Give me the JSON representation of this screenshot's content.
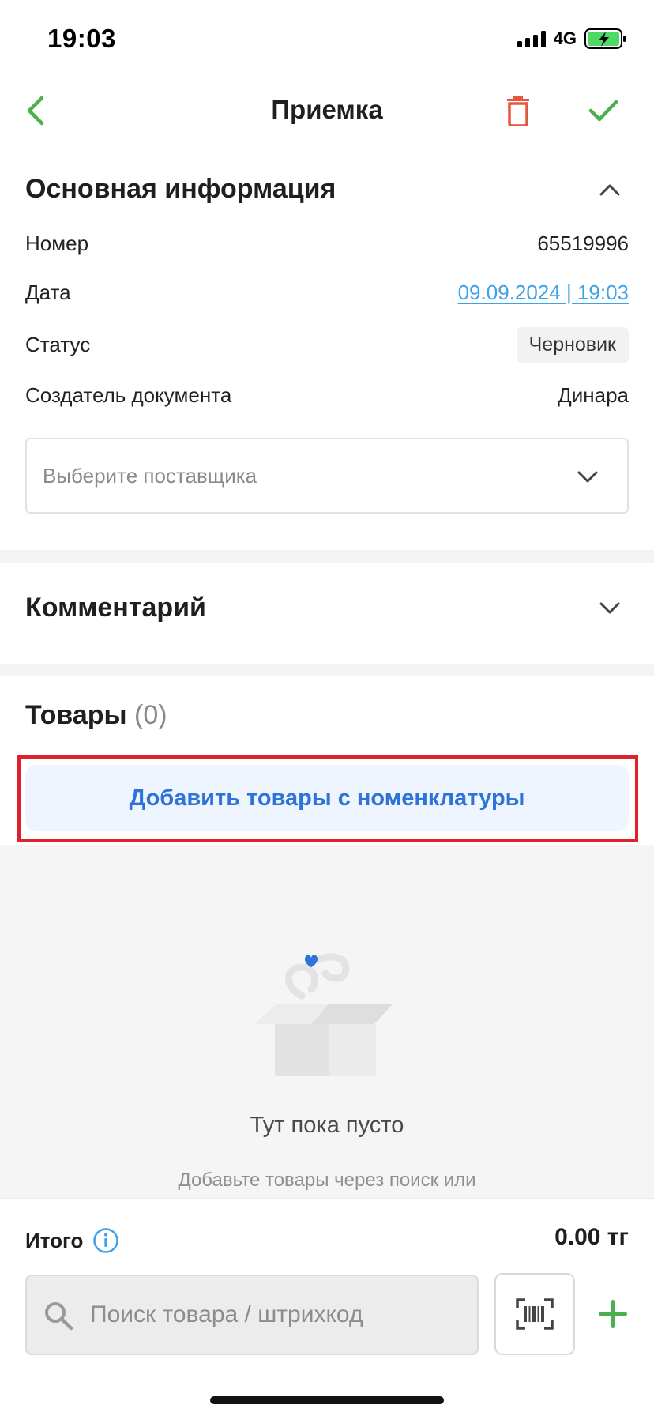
{
  "status_bar": {
    "time": "19:03",
    "network": "4G",
    "icons": [
      "signal-icon",
      "battery-charging-icon"
    ]
  },
  "header": {
    "title": "Приемка",
    "back_icon": "chevron-left-icon",
    "delete_icon": "trash-icon",
    "confirm_icon": "check-icon"
  },
  "colors": {
    "accent_green": "#4caf50",
    "delete_red": "#e5573c",
    "link_blue": "#3ea2ea",
    "button_blue": "#2f73d9",
    "button_bg": "#eef5fe",
    "highlight_red": "#e0212b"
  },
  "main_info": {
    "title": "Основная информация",
    "rows": [
      {
        "label": "Номер",
        "value": "65519996"
      },
      {
        "label": "Дата",
        "value": "09.09.2024 | 19:03"
      },
      {
        "label": "Статус",
        "value": "Черновик"
      },
      {
        "label": "Создатель документа",
        "value": "Динара"
      }
    ],
    "supplier_placeholder": "Выберите поставщика"
  },
  "comment": {
    "title": "Комментарий"
  },
  "products": {
    "title": "Товары",
    "count": "(0)",
    "add_button": "Добавить товары с номенклатуры"
  },
  "empty_state": {
    "title": "Тут пока пусто",
    "subtitle": "Добавьте товары через поиск или"
  },
  "footer": {
    "total_label": "Итого",
    "total_value": "0.00 тг",
    "search_placeholder": "Поиск товара / штрихкод"
  }
}
